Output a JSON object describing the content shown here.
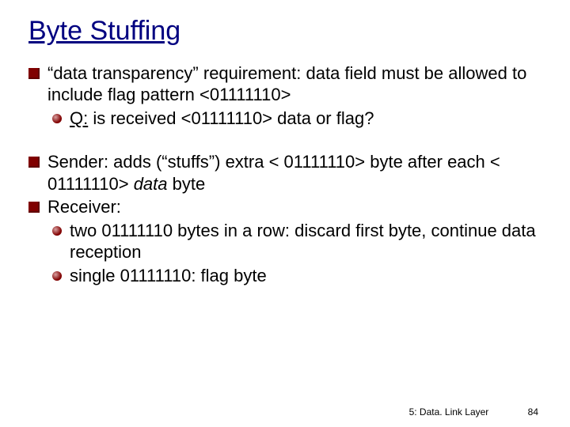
{
  "title": "Byte Stuffing",
  "block1": {
    "bullet": "“data transparency” requirement: data field must be allowed to include flag pattern  <01111110>",
    "sub_q": "Q:",
    "sub_rest": " is received <01111110> data or flag?"
  },
  "block2": {
    "sender_bullet_pre": "Sender: adds (“stuffs”) extra < 01111110> byte after each < 01111110> ",
    "sender_bullet_em": "data",
    "sender_bullet_post": "  byte",
    "receiver_bullet": "Receiver:",
    "receiver_sub1": "two 01111110 bytes in a row: discard first byte, continue data reception",
    "receiver_sub2": "single 01111110: flag byte"
  },
  "footer": {
    "section": "5: Data. Link Layer",
    "page": "84"
  }
}
